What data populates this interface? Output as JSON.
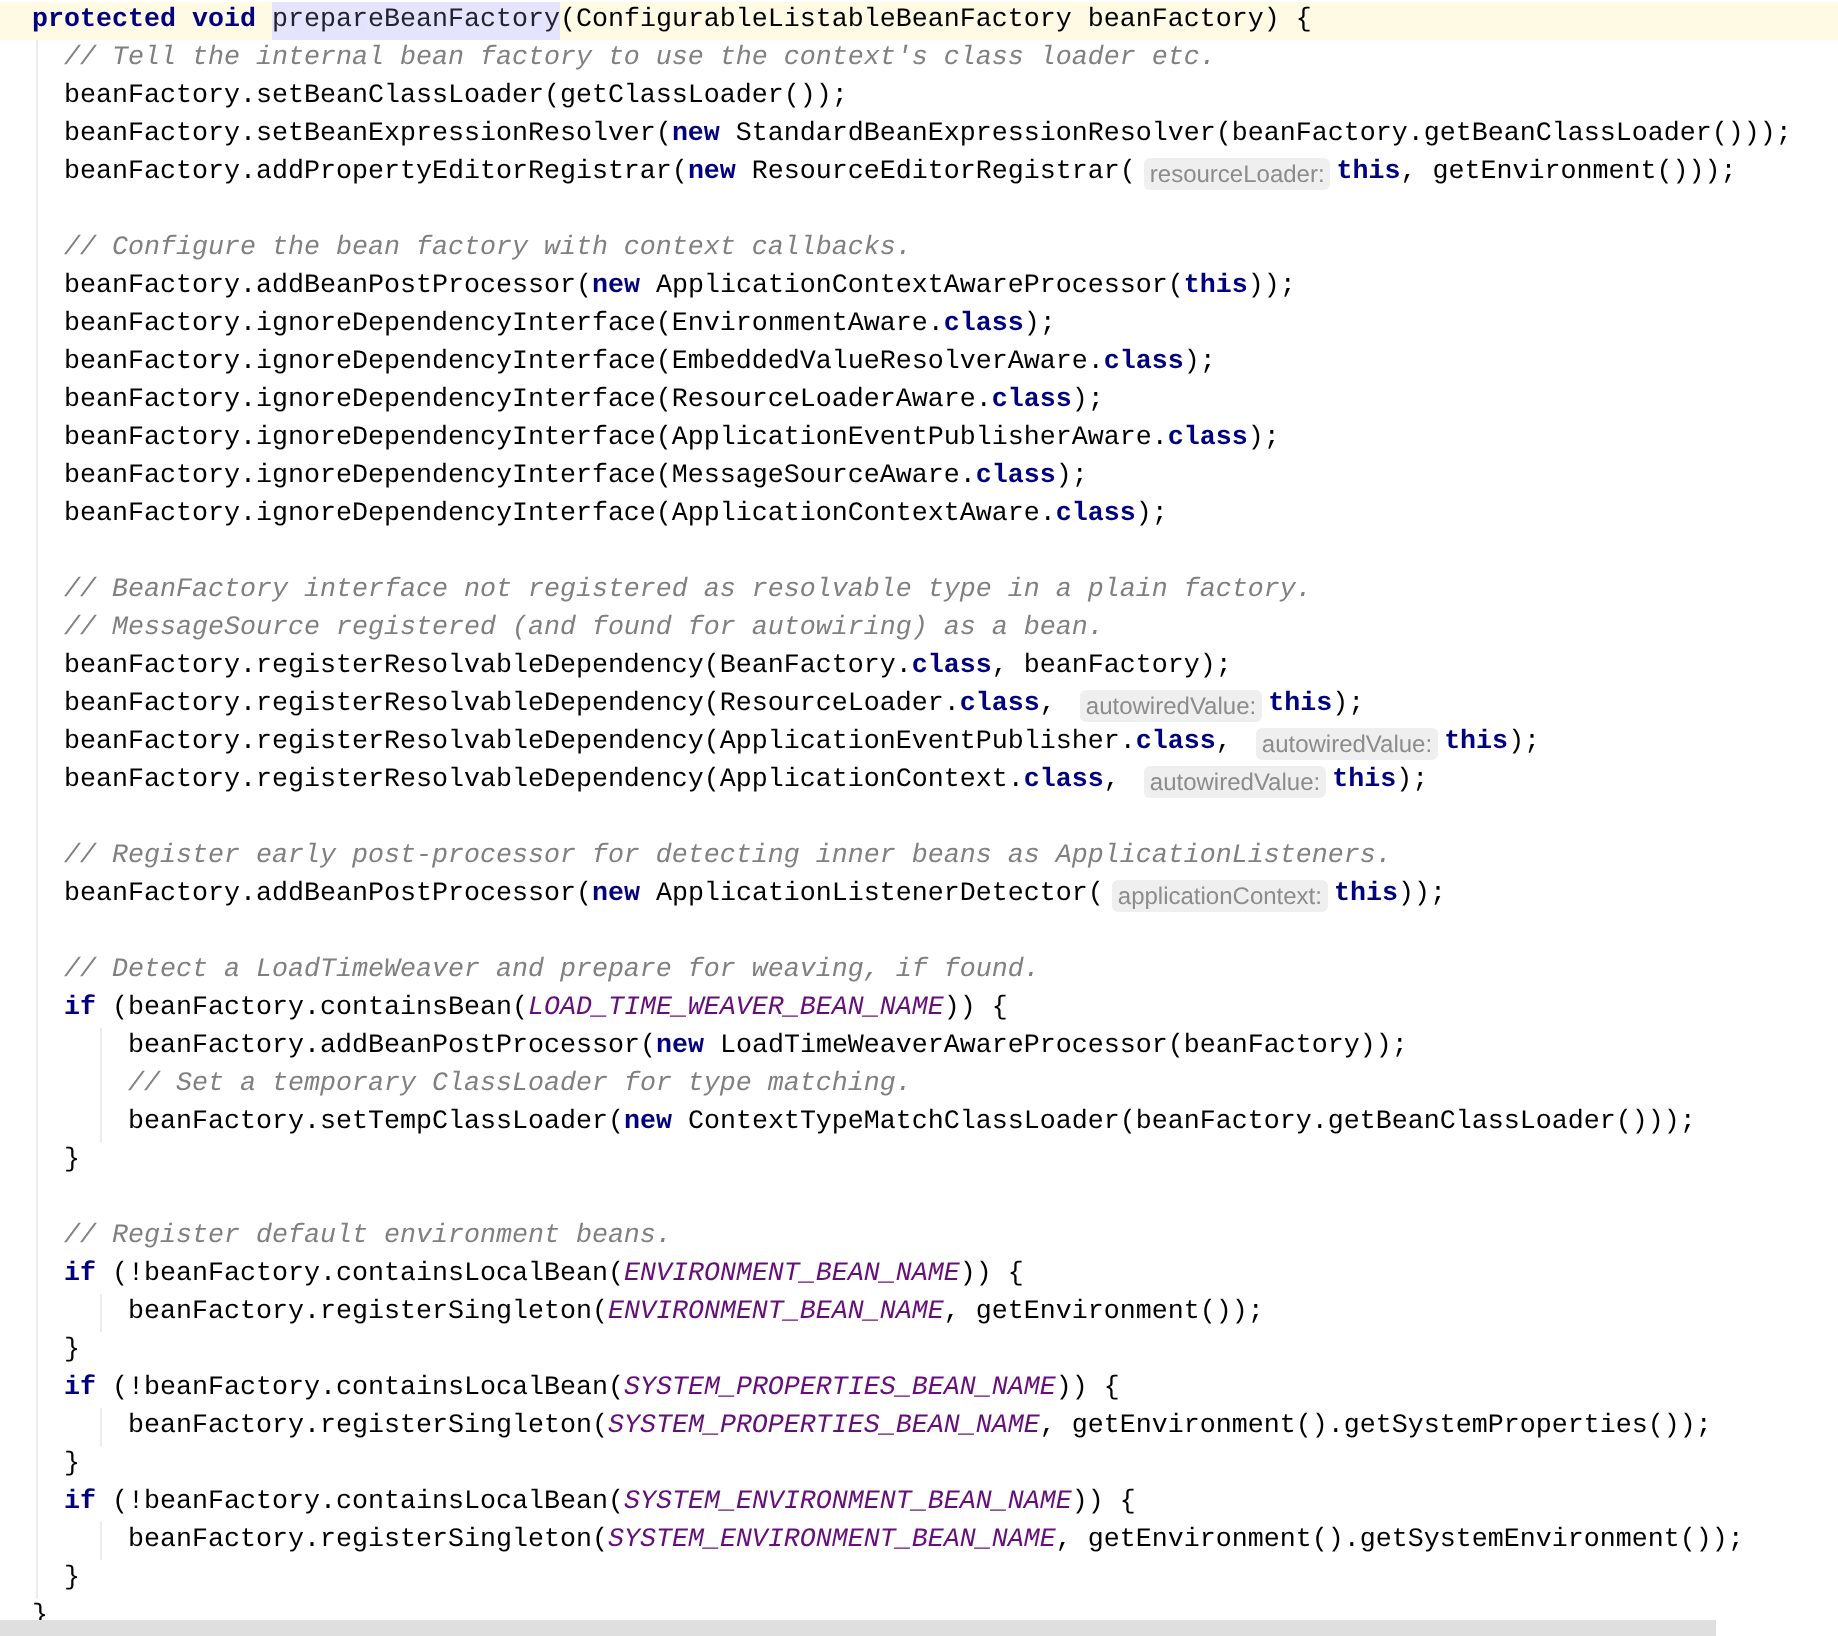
{
  "editor": {
    "lines": [
      {
        "kind": "code",
        "current": true,
        "tokens": [
          {
            "kind": "keyword",
            "text": "protected void "
          },
          {
            "kind": "highlight",
            "text": "prepareBeanFactory"
          },
          {
            "kind": "plain",
            "text": "(ConfigurableListableBeanFactory beanFactory) {"
          }
        ],
        "children": [
          {
            "kind": "code",
            "current": false,
            "tokens": [
              {
                "kind": "comment",
                "text": "// Tell the internal bean factory to use the context's class loader etc."
              }
            ]
          },
          {
            "kind": "code",
            "current": false,
            "tokens": [
              {
                "kind": "plain",
                "text": "beanFactory.setBeanClassLoader(getClassLoader());"
              }
            ]
          },
          {
            "kind": "code",
            "current": false,
            "tokens": [
              {
                "kind": "plain",
                "text": "beanFactory.setBeanExpressionResolver("
              },
              {
                "kind": "keyword",
                "text": "new"
              },
              {
                "kind": "plain",
                "text": " StandardBeanExpressionResolver(beanFactory.getBeanClassLoader()));"
              }
            ]
          },
          {
            "kind": "code",
            "current": false,
            "tokens": [
              {
                "kind": "plain",
                "text": "beanFactory.addPropertyEditorRegistrar("
              },
              {
                "kind": "keyword",
                "text": "new"
              },
              {
                "kind": "plain",
                "text": " ResourceEditorRegistrar("
              },
              {
                "kind": "hint",
                "text": "resourceLoader:"
              },
              {
                "kind": "keyword",
                "text": "this"
              },
              {
                "kind": "plain",
                "text": ", getEnvironment()));"
              }
            ]
          },
          {
            "kind": "blank",
            "current": false
          },
          {
            "kind": "code",
            "current": false,
            "tokens": [
              {
                "kind": "comment",
                "text": "// Configure the bean factory with context callbacks."
              }
            ]
          },
          {
            "kind": "code",
            "current": false,
            "tokens": [
              {
                "kind": "plain",
                "text": "beanFactory.addBeanPostProcessor("
              },
              {
                "kind": "keyword",
                "text": "new"
              },
              {
                "kind": "plain",
                "text": " ApplicationContextAwareProcessor("
              },
              {
                "kind": "keyword",
                "text": "this"
              },
              {
                "kind": "plain",
                "text": "));"
              }
            ]
          },
          {
            "kind": "code",
            "current": false,
            "tokens": [
              {
                "kind": "plain",
                "text": "beanFactory.ignoreDependencyInterface(EnvironmentAware."
              },
              {
                "kind": "keyword",
                "text": "class"
              },
              {
                "kind": "plain",
                "text": ");"
              }
            ]
          },
          {
            "kind": "code",
            "current": false,
            "tokens": [
              {
                "kind": "plain",
                "text": "beanFactory.ignoreDependencyInterface(EmbeddedValueResolverAware."
              },
              {
                "kind": "keyword",
                "text": "class"
              },
              {
                "kind": "plain",
                "text": ");"
              }
            ]
          },
          {
            "kind": "code",
            "current": false,
            "tokens": [
              {
                "kind": "plain",
                "text": "beanFactory.ignoreDependencyInterface(ResourceLoaderAware."
              },
              {
                "kind": "keyword",
                "text": "class"
              },
              {
                "kind": "plain",
                "text": ");"
              }
            ]
          },
          {
            "kind": "code",
            "current": false,
            "tokens": [
              {
                "kind": "plain",
                "text": "beanFactory.ignoreDependencyInterface(ApplicationEventPublisherAware."
              },
              {
                "kind": "keyword",
                "text": "class"
              },
              {
                "kind": "plain",
                "text": ");"
              }
            ]
          },
          {
            "kind": "code",
            "current": false,
            "tokens": [
              {
                "kind": "plain",
                "text": "beanFactory.ignoreDependencyInterface(MessageSourceAware."
              },
              {
                "kind": "keyword",
                "text": "class"
              },
              {
                "kind": "plain",
                "text": ");"
              }
            ]
          },
          {
            "kind": "code",
            "current": false,
            "tokens": [
              {
                "kind": "plain",
                "text": "beanFactory.ignoreDependencyInterface(ApplicationContextAware."
              },
              {
                "kind": "keyword",
                "text": "class"
              },
              {
                "kind": "plain",
                "text": ");"
              }
            ]
          },
          {
            "kind": "blank",
            "current": false
          },
          {
            "kind": "code",
            "current": false,
            "tokens": [
              {
                "kind": "comment",
                "text": "// BeanFactory interface not registered as resolvable type in a plain factory."
              }
            ]
          },
          {
            "kind": "code",
            "current": false,
            "tokens": [
              {
                "kind": "comment",
                "text": "// MessageSource registered (and found for autowiring) as a bean."
              }
            ]
          },
          {
            "kind": "code",
            "current": false,
            "tokens": [
              {
                "kind": "plain",
                "text": "beanFactory.registerResolvableDependency(BeanFactory."
              },
              {
                "kind": "keyword",
                "text": "class"
              },
              {
                "kind": "plain",
                "text": ", beanFactory);"
              }
            ]
          },
          {
            "kind": "code",
            "current": false,
            "tokens": [
              {
                "kind": "plain",
                "text": "beanFactory.registerResolvableDependency(ResourceLoader."
              },
              {
                "kind": "keyword",
                "text": "class"
              },
              {
                "kind": "plain",
                "text": ", "
              },
              {
                "kind": "hint",
                "text": "autowiredValue:"
              },
              {
                "kind": "keyword",
                "text": "this"
              },
              {
                "kind": "plain",
                "text": ");"
              }
            ]
          },
          {
            "kind": "code",
            "current": false,
            "tokens": [
              {
                "kind": "plain",
                "text": "beanFactory.registerResolvableDependency(ApplicationEventPublisher."
              },
              {
                "kind": "keyword",
                "text": "class"
              },
              {
                "kind": "plain",
                "text": ", "
              },
              {
                "kind": "hint",
                "text": "autowiredValue:"
              },
              {
                "kind": "keyword",
                "text": "this"
              },
              {
                "kind": "plain",
                "text": ");"
              }
            ]
          },
          {
            "kind": "code",
            "current": false,
            "tokens": [
              {
                "kind": "plain",
                "text": "beanFactory.registerResolvableDependency(ApplicationContext."
              },
              {
                "kind": "keyword",
                "text": "class"
              },
              {
                "kind": "plain",
                "text": ", "
              },
              {
                "kind": "hint",
                "text": "autowiredValue:"
              },
              {
                "kind": "keyword",
                "text": "this"
              },
              {
                "kind": "plain",
                "text": ");"
              }
            ]
          },
          {
            "kind": "blank",
            "current": false
          },
          {
            "kind": "code",
            "current": false,
            "tokens": [
              {
                "kind": "comment",
                "text": "// Register early post-processor for detecting inner beans as ApplicationListeners."
              }
            ]
          },
          {
            "kind": "code",
            "current": false,
            "tokens": [
              {
                "kind": "plain",
                "text": "beanFactory.addBeanPostProcessor("
              },
              {
                "kind": "keyword",
                "text": "new"
              },
              {
                "kind": "plain",
                "text": " ApplicationListenerDetector("
              },
              {
                "kind": "hint",
                "text": "applicationContext:"
              },
              {
                "kind": "keyword",
                "text": "this"
              },
              {
                "kind": "plain",
                "text": "));"
              }
            ]
          },
          {
            "kind": "blank",
            "current": false
          },
          {
            "kind": "code",
            "current": false,
            "tokens": [
              {
                "kind": "comment",
                "text": "// Detect a LoadTimeWeaver and prepare for weaving, if found."
              }
            ]
          },
          {
            "kind": "code",
            "current": false,
            "tokens": [
              {
                "kind": "keyword",
                "text": "if"
              },
              {
                "kind": "plain",
                "text": " (beanFactory.containsBean("
              },
              {
                "kind": "constant",
                "text": "LOAD_TIME_WEAVER_BEAN_NAME"
              },
              {
                "kind": "plain",
                "text": ")) {"
              }
            ],
            "children": [
              {
                "kind": "code",
                "current": false,
                "tokens": [
                  {
                    "kind": "plain",
                    "text": "beanFactory.addBeanPostProcessor("
                  },
                  {
                    "kind": "keyword",
                    "text": "new"
                  },
                  {
                    "kind": "plain",
                    "text": " LoadTimeWeaverAwareProcessor(beanFactory));"
                  }
                ]
              },
              {
                "kind": "code",
                "current": false,
                "tokens": [
                  {
                    "kind": "comment",
                    "text": "// Set a temporary ClassLoader for type matching."
                  }
                ]
              },
              {
                "kind": "code",
                "current": false,
                "tokens": [
                  {
                    "kind": "plain",
                    "text": "beanFactory.setTempClassLoader("
                  },
                  {
                    "kind": "keyword",
                    "text": "new"
                  },
                  {
                    "kind": "plain",
                    "text": " ContextTypeMatchClassLoader(beanFactory.getBeanClassLoader()));"
                  }
                ]
              }
            ]
          },
          {
            "kind": "code",
            "current": false,
            "tokens": [
              {
                "kind": "plain",
                "text": "}"
              }
            ]
          },
          {
            "kind": "blank",
            "current": false
          },
          {
            "kind": "code",
            "current": false,
            "tokens": [
              {
                "kind": "comment",
                "text": "// Register default environment beans."
              }
            ]
          },
          {
            "kind": "code",
            "current": false,
            "tokens": [
              {
                "kind": "keyword",
                "text": "if"
              },
              {
                "kind": "plain",
                "text": " (!beanFactory.containsLocalBean("
              },
              {
                "kind": "constant",
                "text": "ENVIRONMENT_BEAN_NAME"
              },
              {
                "kind": "plain",
                "text": ")) {"
              }
            ],
            "children": [
              {
                "kind": "code",
                "current": false,
                "tokens": [
                  {
                    "kind": "plain",
                    "text": "beanFactory.registerSingleton("
                  },
                  {
                    "kind": "constant",
                    "text": "ENVIRONMENT_BEAN_NAME"
                  },
                  {
                    "kind": "plain",
                    "text": ", getEnvironment());"
                  }
                ]
              }
            ]
          },
          {
            "kind": "code",
            "current": false,
            "tokens": [
              {
                "kind": "plain",
                "text": "}"
              }
            ]
          },
          {
            "kind": "code",
            "current": false,
            "tokens": [
              {
                "kind": "keyword",
                "text": "if"
              },
              {
                "kind": "plain",
                "text": " (!beanFactory.containsLocalBean("
              },
              {
                "kind": "constant",
                "text": "SYSTEM_PROPERTIES_BEAN_NAME"
              },
              {
                "kind": "plain",
                "text": ")) {"
              }
            ],
            "children": [
              {
                "kind": "code",
                "current": false,
                "tokens": [
                  {
                    "kind": "plain",
                    "text": "beanFactory.registerSingleton("
                  },
                  {
                    "kind": "constant",
                    "text": "SYSTEM_PROPERTIES_BEAN_NAME"
                  },
                  {
                    "kind": "plain",
                    "text": ", getEnvironment().getSystemProperties());"
                  }
                ]
              }
            ]
          },
          {
            "kind": "code",
            "current": false,
            "tokens": [
              {
                "kind": "plain",
                "text": "}"
              }
            ]
          },
          {
            "kind": "code",
            "current": false,
            "tokens": [
              {
                "kind": "keyword",
                "text": "if"
              },
              {
                "kind": "plain",
                "text": " (!beanFactory.containsLocalBean("
              },
              {
                "kind": "constant",
                "text": "SYSTEM_ENVIRONMENT_BEAN_NAME"
              },
              {
                "kind": "plain",
                "text": ")) {"
              }
            ],
            "children": [
              {
                "kind": "code",
                "current": false,
                "tokens": [
                  {
                    "kind": "plain",
                    "text": "beanFactory.registerSingleton("
                  },
                  {
                    "kind": "constant",
                    "text": "SYSTEM_ENVIRONMENT_BEAN_NAME"
                  },
                  {
                    "kind": "plain",
                    "text": ", getEnvironment().getSystemEnvironment());"
                  }
                ]
              }
            ]
          },
          {
            "kind": "code",
            "current": false,
            "tokens": [
              {
                "kind": "plain",
                "text": "}"
              }
            ]
          }
        ]
      },
      {
        "kind": "code",
        "current": false,
        "tokens": [
          {
            "kind": "plain",
            "text": "}"
          }
        ]
      }
    ]
  }
}
